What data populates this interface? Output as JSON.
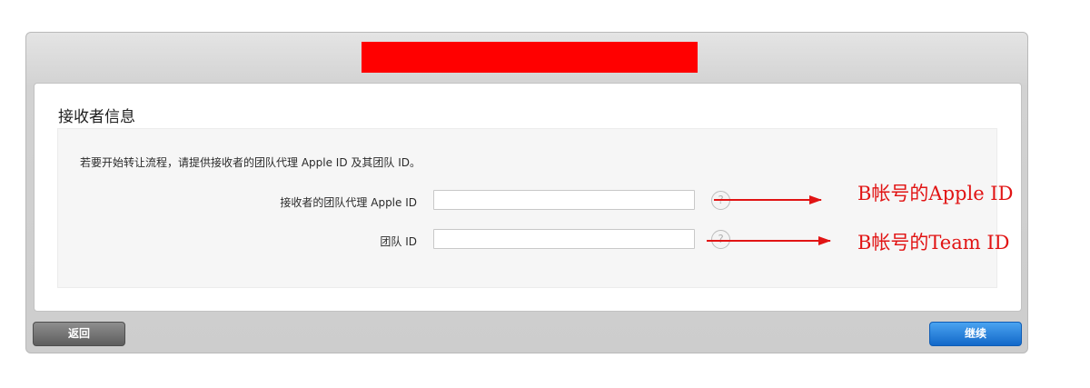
{
  "dialog": {
    "title": "接收者信息",
    "intro": "若要开始转让流程，请提供接收者的团队代理 Apple ID 及其团队 ID。",
    "fields": [
      {
        "label": "接收者的团队代理 Apple ID",
        "value": "",
        "help": "?"
      },
      {
        "label": "团队 ID",
        "value": "",
        "help": "?"
      }
    ],
    "buttons": {
      "back": "返回",
      "continue": "继续"
    }
  },
  "annotations": {
    "apple_id_note": "B帐号的Apple ID",
    "team_id_note": "B帐号的Team ID",
    "color": "#e11414"
  },
  "colors": {
    "redaction": "#ff0000",
    "primary_button": "#1f7ae0",
    "secondary_button": "#6e6e6e"
  }
}
